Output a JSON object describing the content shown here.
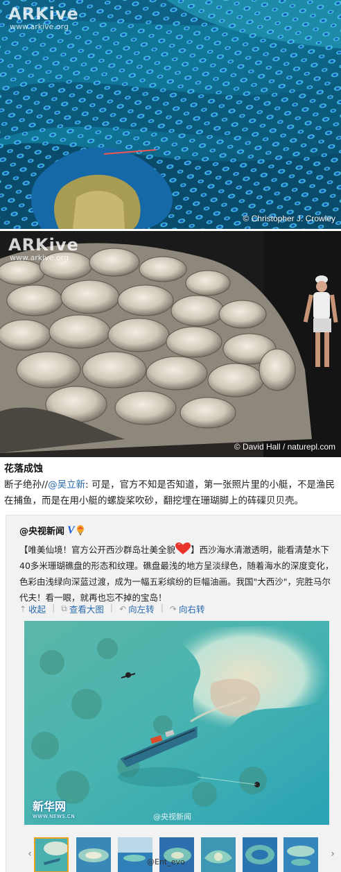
{
  "photo1": {
    "logo": "ARKive",
    "url": "www.arkive.org",
    "credit": "© Christopher J. Crowley"
  },
  "photo2": {
    "logo": "ARKive",
    "url": "www.arkive.org",
    "credit": "© David Hall / naturepl.com"
  },
  "post": {
    "title": "花落成蚀",
    "author_prefix": "断子绝孙//",
    "author_mention": "@吴立新",
    "text": ": 可是，官方不知是否知道，第一张照片里的小艇，不是渔民在捕鱼，而是在用小艇的螺旋桨吹砂，翻挖埋在珊瑚脚上的砗磲贝贝壳。"
  },
  "repost": {
    "source_name": "@央视新闻",
    "text_before_heart": "【唯美仙境！官方公开西沙群岛壮美全貌",
    "text_after_heart": "】西沙海水清澈透明，能看清楚水下40多米珊瑚礁盘的形态和纹理。礁盘最浅的地方呈淡绿色，随着海水的深度变化，色彩由浅绿向深蓝过渡，成为一幅五彩缤纷的巨幅油画。我国\"大西沙\"，完胜马尔代夫！看一眼，就再也忘不掉的宝岛！",
    "actions": {
      "collapse": "收起",
      "view_large": "查看大图",
      "rotate_left": "向左转",
      "rotate_right": "向右转"
    },
    "image_watermark_xinhua": "新华网",
    "image_watermark_xinhua_url": "WWW.NEWS.CN",
    "image_watermark_cctv": "@央视新闻"
  },
  "footer_watermark": "@Ent_evo",
  "colors": {
    "link": "#2a6ab0",
    "card_bg": "#f2f2f2",
    "active_thumb_border": "#f0a020"
  }
}
